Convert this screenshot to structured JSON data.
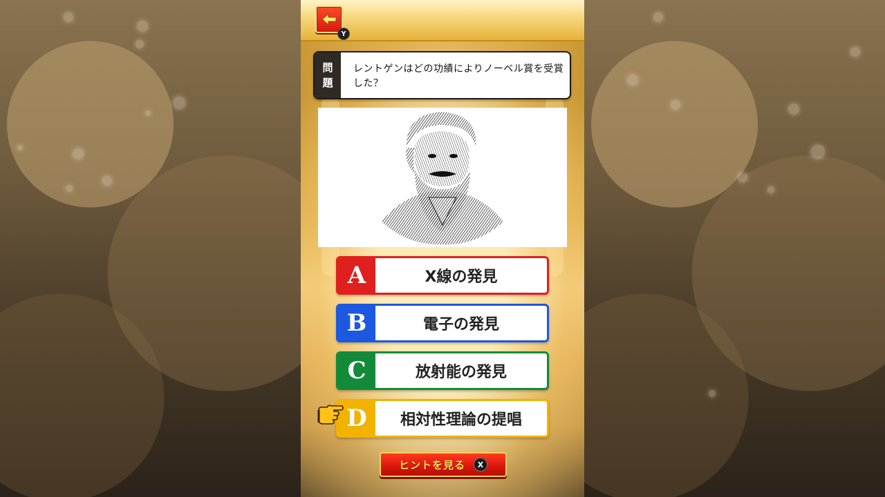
{
  "header": {
    "back_icon": "arrow-left-icon",
    "back_key": "Y"
  },
  "question": {
    "label_line1": "問",
    "label_line2": "題",
    "text": "レントゲンはどの功績によりノーベル賞を受賞した？"
  },
  "portrait": {
    "icon": "engraved-portrait-bearded-man"
  },
  "answers": [
    {
      "letter": "A",
      "text": "X線の発見",
      "color": "#e0201e"
    },
    {
      "letter": "B",
      "text": "電子の発見",
      "color": "#1c58e0"
    },
    {
      "letter": "C",
      "text": "放射能の発見",
      "color": "#128a3a"
    },
    {
      "letter": "D",
      "text": "相対性理論の提唱",
      "color": "#f2b300",
      "selected": true
    }
  ],
  "hint": {
    "label": "ヒントを見る",
    "key": "X"
  },
  "colors": {
    "accent_red": "#e0201e",
    "gold": "#f6d67a"
  }
}
